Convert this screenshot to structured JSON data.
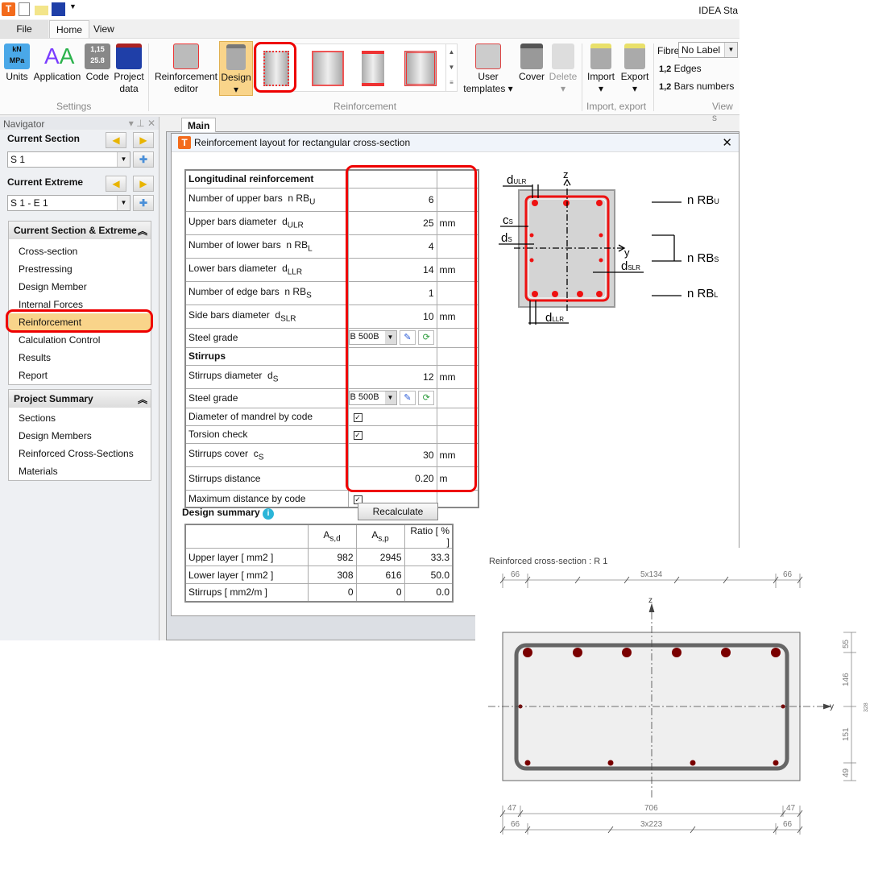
{
  "app": {
    "title": "IDEA Sta"
  },
  "tabs": [
    "File",
    "Home",
    "View"
  ],
  "ribbon": {
    "settings": {
      "label": "Settings",
      "buttons": [
        "Units",
        "Application",
        "Code",
        "Project data"
      ]
    },
    "reinforcement": {
      "label": "Reinforcement",
      "editor": "Reinforcement editor",
      "design": "Design",
      "user_templates": "User templates",
      "cover": "Cover",
      "delete": "Delete"
    },
    "import_export": {
      "label": "Import, export",
      "import": "Import",
      "export": "Export"
    },
    "view": {
      "label": "View s",
      "fibre": "Fibre",
      "fibre_value": "No Label",
      "edges": "Edges",
      "bars_numbers": "Bars numbers",
      "num_icon": "1,2"
    }
  },
  "navigator": {
    "title": "Navigator",
    "current_section_label": "Current Section",
    "current_section": "S 1",
    "current_extreme_label": "Current Extreme",
    "current_extreme": "S 1 - E 1",
    "panel1": {
      "title": "Current Section & Extreme",
      "items": [
        "Cross-section",
        "Prestressing",
        "Design Member",
        "Internal Forces",
        "Reinforcement",
        "Calculation Control",
        "Results",
        "Report"
      ],
      "selected": "Reinforcement"
    },
    "panel2": {
      "title": "Project Summary",
      "items": [
        "Sections",
        "Design Members",
        "Reinforced Cross-Sections",
        "Materials"
      ]
    }
  },
  "main_tab": "Main",
  "dialog": {
    "title": "Reinforcement layout for rectangular cross-section",
    "section1": "Longitudinal reinforcement",
    "rows": [
      {
        "label": "Number of upper bars",
        "sym": "n RB",
        "sub": "U",
        "value": "6",
        "unit": ""
      },
      {
        "label": "Upper bars diameter",
        "sym": "d",
        "sub": "ULR",
        "value": "25",
        "unit": "mm"
      },
      {
        "label": "Number of lower bars",
        "sym": "n RB",
        "sub": "L",
        "value": "4",
        "unit": ""
      },
      {
        "label": "Lower bars diameter",
        "sym": "d",
        "sub": "LLR",
        "value": "14",
        "unit": "mm"
      },
      {
        "label": "Number of edge bars",
        "sym": "n RB",
        "sub": "S",
        "value": "1",
        "unit": ""
      },
      {
        "label": "Side bars diameter",
        "sym": "d",
        "sub": "SLR",
        "value": "10",
        "unit": "mm"
      },
      {
        "label": "Steel grade",
        "value": "B 500B"
      }
    ],
    "section2": "Stirrups",
    "rows2": [
      {
        "label": "Stirrups diameter",
        "sym": "d",
        "sub": "S",
        "value": "12",
        "unit": "mm"
      },
      {
        "label": "Steel grade",
        "value": "B 500B"
      },
      {
        "label": "Diameter of mandrel by code",
        "checked": true
      },
      {
        "label": "Torsion check",
        "checked": true
      },
      {
        "label": "Stirrups cover",
        "sym": "c",
        "sub": "S",
        "value": "30",
        "unit": "mm"
      },
      {
        "label": "Stirrups distance",
        "value": "0.20",
        "unit": "m"
      },
      {
        "label": "Maximum distance by code",
        "checked": true
      }
    ],
    "summary": {
      "title": "Design summary",
      "recalculate": "Recalculate",
      "headers": [
        "",
        "A s,d",
        "A s,p",
        "Ratio  [ % ]"
      ],
      "rows": [
        [
          "Upper layer  [ mm2 ]",
          "982",
          "2945",
          "33.3"
        ],
        [
          "Lower layer  [ mm2 ]",
          "308",
          "616",
          "50.0"
        ],
        [
          "Stirrups  [ mm2/m ]",
          "0",
          "0",
          "0.0"
        ]
      ]
    },
    "diagram": {
      "z": "z",
      "y": "y",
      "d_ulr": "d",
      "d_ulr_sub": "ULR",
      "c_s": "c",
      "c_s_sub": "S",
      "d_s": "d",
      "d_s_sub": "S",
      "d_slr": "d",
      "d_slr_sub": "SLR",
      "d_llr": "d",
      "d_llr_sub": "LLR",
      "rbu": "n RB",
      "rbu_sub": "U",
      "rbs": "n RB",
      "rbs_sub": "S",
      "rbl": "n RB",
      "rbl_sub": "L"
    }
  },
  "drawing": {
    "title": "Reinforced cross-section : R 1",
    "top_dims": [
      "66",
      "5x134",
      "66"
    ],
    "bottom_dims1": [
      "47",
      "706",
      "47"
    ],
    "bottom_dims2": [
      "66",
      "3x223",
      "66"
    ],
    "right_dims": [
      "55",
      "146",
      "151",
      "49"
    ],
    "height": "328",
    "z": "z",
    "y": "y"
  },
  "colors": {
    "highlight": "#e00000",
    "bar": "#7a0000",
    "accent": "#f9d48a"
  }
}
